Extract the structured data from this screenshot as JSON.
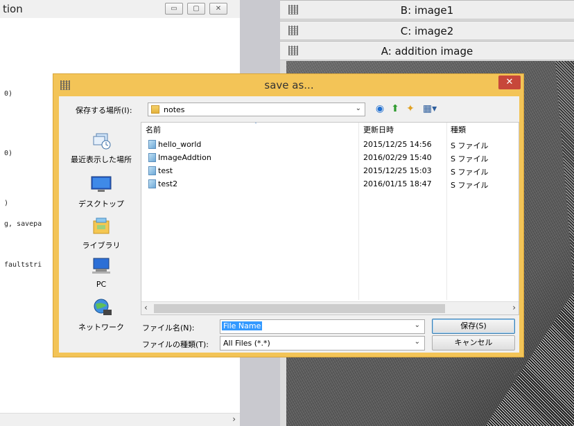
{
  "editor": {
    "title": "tion",
    "buttons": {
      "minimize": "▭",
      "maximize": "▢",
      "close": "✕"
    },
    "code_lines": [
      "0)",
      "0)",
      ")",
      "g, savepa",
      "faultstri"
    ],
    "scroll_right": "›"
  },
  "windows": [
    {
      "title": "B: image1"
    },
    {
      "title": "C: image2"
    },
    {
      "title": "A: addition image"
    }
  ],
  "dialog": {
    "title": "save as...",
    "close": "✕",
    "location_label": "保存する場所(I):",
    "location_value": "notes",
    "location_arrow": "⌄",
    "toolbar": {
      "back": "◉",
      "up": "⬆",
      "new_folder": "✦",
      "view": "▦▾"
    },
    "places": [
      {
        "label": "最近表示した場所",
        "icon": "recent-places-icon"
      },
      {
        "label": "デスクトップ",
        "icon": "desktop-icon"
      },
      {
        "label": "ライブラリ",
        "icon": "libraries-icon"
      },
      {
        "label": "PC",
        "icon": "computer-icon"
      },
      {
        "label": "ネットワーク",
        "icon": "network-icon"
      }
    ],
    "columns": {
      "name": "名前",
      "modified": "更新日時",
      "type": "種類",
      "sort_indicator": "˄"
    },
    "files": [
      {
        "name": "hello_world",
        "modified": "2015/12/25 14:56",
        "type": "S ファイル"
      },
      {
        "name": "ImageAddtion",
        "modified": "2016/02/29 15:40",
        "type": "S ファイル"
      },
      {
        "name": "test",
        "modified": "2015/12/25 15:03",
        "type": "S ファイル"
      },
      {
        "name": "test2",
        "modified": "2016/01/15 18:47",
        "type": "S ファイル"
      }
    ],
    "list_scroll": {
      "left": "‹",
      "right": "›"
    },
    "filename_label": "ファイル名(N):",
    "filename_value": "File Name",
    "filetype_label": "ファイルの種類(T):",
    "filetype_value": "All Files (*.*)",
    "combo_arrow": "⌄",
    "save_label": "保存(S)",
    "cancel_label": "キャンセル",
    "grip": "⋰"
  },
  "colors": {
    "dialog_frame": "#f3c457",
    "close_button": "#c7473a",
    "selection": "#3399ff"
  }
}
